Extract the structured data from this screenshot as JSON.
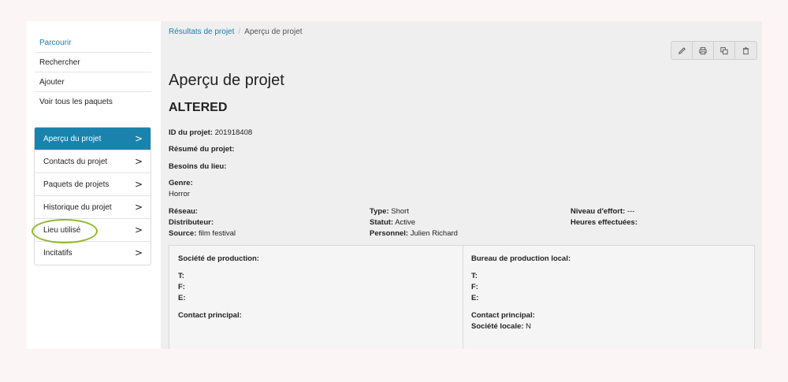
{
  "sidebar": {
    "top_items": [
      {
        "label": "Parcourir"
      },
      {
        "label": "Rechercher"
      },
      {
        "label": "Ajouter"
      },
      {
        "label": "Voir tous les paquets"
      }
    ],
    "sub_items": [
      {
        "label": "Aperçu du projet"
      },
      {
        "label": "Contacts du projet"
      },
      {
        "label": "Paquets de projets"
      },
      {
        "label": "Historique du projet"
      },
      {
        "label": "Lieu utilisé"
      },
      {
        "label": "Incitatifs"
      }
    ],
    "chevron": ">"
  },
  "breadcrumb": {
    "link": "Résultats de projet",
    "separator": "/",
    "current": "Aperçu de projet"
  },
  "toolbar": {
    "icons": [
      "pencil-icon",
      "print-icon",
      "copy-icon",
      "trash-icon"
    ]
  },
  "page": {
    "title": "Aperçu de projet",
    "project_name": "ALTERED"
  },
  "details": {
    "id_label": "ID du projet:",
    "id_value": "201918408",
    "summary_label": "Résumé du projet:",
    "needs_label": "Besoins du lieu:",
    "genre_label": "Genre:",
    "genre_value": "Horror"
  },
  "info": {
    "col1": [
      {
        "label": "Réseau:",
        "value": ""
      },
      {
        "label": "Distributeur:",
        "value": ""
      },
      {
        "label": "Source:",
        "value": "film festival"
      }
    ],
    "col2": [
      {
        "label": "Type:",
        "value": "Short"
      },
      {
        "label": "Statut:",
        "value": "Active"
      },
      {
        "label": "Personnel:",
        "value": "Julien Richard"
      }
    ],
    "col3": [
      {
        "label": "Niveau d'effort:",
        "value": "---"
      },
      {
        "label": "Heures effectuées:",
        "value": ""
      }
    ]
  },
  "contacts": {
    "left": {
      "heading": "Société de production:",
      "t": "T:",
      "f": "F:",
      "e": "E:",
      "main_contact": "Contact principal:"
    },
    "right": {
      "heading": "Bureau de production local:",
      "t": "T:",
      "f": "F:",
      "e": "E:",
      "main_contact": "Contact principal:",
      "local_label": "Société locale:",
      "local_value": "N"
    }
  },
  "colors": {
    "accent": "#1983ad",
    "link": "#1a7fae",
    "highlight": "#8fb82f"
  }
}
